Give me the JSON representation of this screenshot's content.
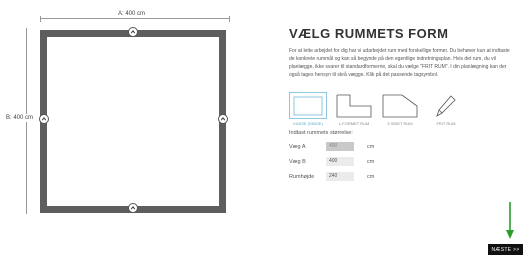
{
  "room": {
    "width_label": "A: 400 cm",
    "height_label": "B: 400 cm"
  },
  "panel": {
    "title": "VÆLG RUMMETS FORM",
    "description": "For at lette arbejdet for dig har vi udarbejdet rum med forskellige former. Du behøver kun at indtaste de konkrete rummål og kan så begynde på den egentlige indretningsplan. Hvis det rum, du vil planlægge, ikke svarer til standardformerne, skal du vælge \"FRIT RUM\". I din planlægning kan der også tages hensyn til skrå vægge. Klik på det passende tagsymbol."
  },
  "shapes": [
    {
      "label": "KASSE (SNIGE)",
      "icon": "square-room-icon",
      "selected": true
    },
    {
      "label": "L-FORMET RUM",
      "icon": "l-shaped-room-icon",
      "selected": false
    },
    {
      "label": "5 SIDET RUM",
      "icon": "five-sided-room-icon",
      "selected": false
    },
    {
      "label": "FRIT RUM",
      "icon": "pencil-icon",
      "selected": false
    }
  ],
  "sizes": {
    "title": "Indtast rummets størrelse:",
    "wall_a": {
      "label": "Væg A",
      "value": "400",
      "unit": "cm"
    },
    "wall_b": {
      "label": "Væg B",
      "value": "400",
      "unit": "cm"
    },
    "height": {
      "label": "Rumhøjde",
      "value": "240",
      "unit": "cm"
    }
  },
  "next_button": "NÆSTE >>",
  "colors": {
    "wall": "#5e5e5e",
    "selected": "#8ec7e0",
    "arrow": "#2a9d2a",
    "button": "#111111"
  }
}
